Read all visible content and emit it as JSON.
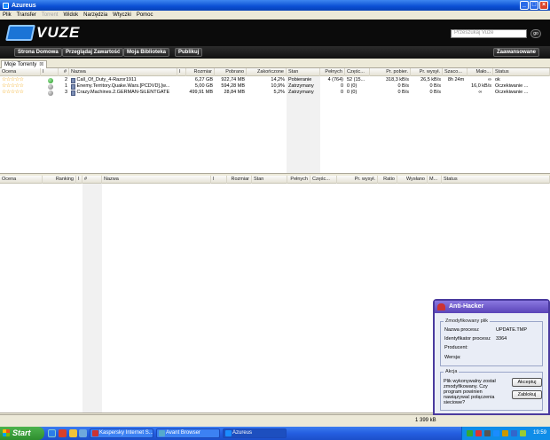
{
  "window": {
    "title": "Azureus",
    "min": "_",
    "max": "□",
    "close": "×"
  },
  "menu": [
    "Plik",
    "Transfer",
    "Torrent",
    "Widok",
    "Narzędzia",
    "Wtyczki",
    "Pomoc"
  ],
  "vuze": {
    "logo": "VUZE",
    "search_placeholder": "Przeszukaj Vuze",
    "go": "go"
  },
  "nav": {
    "home": "Strona Domowa",
    "browse": "Przeglądaj Zawartość",
    "library": "Moja Biblioteka",
    "publish": "Publikuj",
    "advanced": "Zaawansowane"
  },
  "tab": {
    "label": "Moje Torrenty",
    "close": "⊠"
  },
  "top_table": {
    "headers": [
      "Ocena",
      "I",
      "#",
      "Nazwa",
      "I",
      "Rozmiar",
      "Pobrano",
      "Zakończone",
      "Stan",
      "Pełnych",
      "Częśc...",
      "Pr. pobier.",
      "Pr. wysył.",
      "Szaco...",
      "Mało...",
      "Status"
    ],
    "rows": [
      {
        "rating": "☆☆☆☆☆",
        "health": "green",
        "num": "2",
        "name": "Call_Of_Duty_4-Razor1911",
        "size": "6,27 GB",
        "downloaded": "922,74 MB",
        "done": "14,2%",
        "state": "Pobieranie",
        "seeds": "4 (764)",
        "peers": "52 (15...",
        "down": "318,3 kB/s",
        "up": "26,5 kB/s",
        "eta": "8h 24m",
        "shared": "∞",
        "status": "ok"
      },
      {
        "rating": "☆☆☆☆☆",
        "health": "grey",
        "num": "1",
        "name": "Enemy.Territory.Quake.Wars.[PCDVD].[w...",
        "size": "5,00 GB",
        "downloaded": "594,28 MB",
        "done": "10,9%",
        "state": "Zatrzymany",
        "seeds": "0",
        "peers": "0 (0)",
        "down": "0 B/s",
        "up": "0 B/s",
        "eta": "",
        "shared": "16,0 kB/s",
        "status": "Oczekiwanie ..."
      },
      {
        "rating": "☆☆☆☆☆",
        "health": "grey",
        "num": "3",
        "name": "Crazy.Machines.2.GERMAN-SiLENTGATE",
        "size": "499,91 MB",
        "downloaded": "28,84 MB",
        "done": "5,2%",
        "state": "Zatrzymany",
        "seeds": "0",
        "peers": "0 (0)",
        "down": "0 B/s",
        "up": "0 B/s",
        "eta": "",
        "shared": "∞",
        "status": "Oczekiwanie ..."
      }
    ]
  },
  "bottom_table": {
    "headers": [
      "Ocena",
      "Ranking",
      "I",
      "#",
      "Nazwa",
      "I",
      "Rozmiar",
      "Stan",
      "Pełnych",
      "Częśc...",
      "Pr. wysył.",
      "Ratio",
      "Wysłano",
      "M...",
      "Status"
    ]
  },
  "status": {
    "text": "1 399 kB"
  },
  "taskbar": {
    "start": "Start",
    "tasks": [
      "Kaspersky Internet S...",
      "Avant Browser",
      "Azureus"
    ],
    "clock": "19:59"
  },
  "popup": {
    "title": "Anti-Hacker",
    "group1": "Zmodyfikowany plik",
    "process_label": "Nazwa procesu:",
    "process_value": "UPDATE.TMP",
    "pid_label": "Identyfikator procesu:",
    "pid_value": "3364",
    "producer_label": "Producent:",
    "version_label": "Wersja:",
    "group2": "Akcja",
    "message": "Plik wykonywalny został zmodyfikowany. Czy program powinien nawiązywać połączenia sieciowe?",
    "accept": "Akceptuj",
    "block": "Zablokuj"
  },
  "colors": {
    "accent": "#0a4fd4",
    "vuze_blue": "#1a74d6",
    "star": "#f0a000",
    "popup_border": "#4a3a9e"
  }
}
